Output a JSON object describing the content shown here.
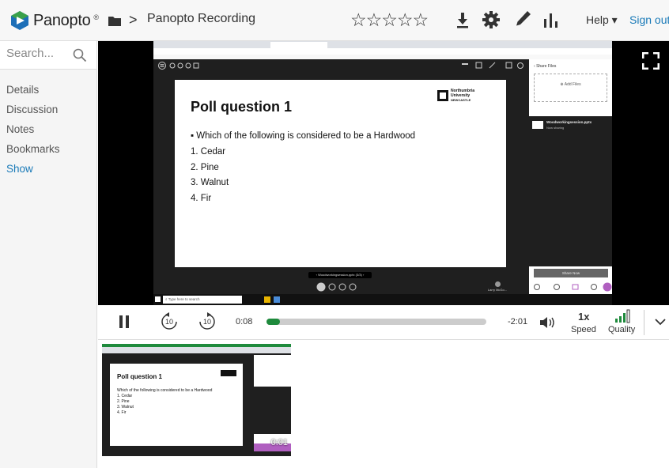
{
  "header": {
    "brand": "Panopto",
    "brand_mark": "®",
    "breadcrumb_separator": ">",
    "title": "Panopto Recording",
    "rating_stars": "☆☆☆☆☆",
    "help_label": "Help ▾",
    "signout_label": "Sign out"
  },
  "sidebar": {
    "search_placeholder": "Search...",
    "items": [
      {
        "label": "Details"
      },
      {
        "label": "Discussion"
      },
      {
        "label": "Notes"
      },
      {
        "label": "Bookmarks"
      },
      {
        "label": "Show"
      }
    ]
  },
  "slide": {
    "title": "Poll question 1",
    "question": "Which of the following is considered to be a Hardwood",
    "options": [
      "1.  Cedar",
      "2.  Pine",
      "3.  Walnut",
      "4.  Fir"
    ],
    "logo_lines": [
      "Northumbria",
      "University",
      "NEWCASTLE"
    ]
  },
  "teams": {
    "share_title": "Share Files",
    "add_files": "Add Files",
    "file_name": "Woodworkingsession.pptx",
    "now_sharing": "Now sharing",
    "share_now": "Share Now",
    "presentation_label": "Woodworkingsession.pptx (3/3)",
    "participant": "Larry McGo...",
    "taskbar_search": "Type here to search"
  },
  "player": {
    "elapsed": "0:08",
    "remaining": "-2:01",
    "progress": 0.06,
    "skip_back": "10",
    "skip_forward": "10",
    "speed_value": "1x",
    "speed_label": "Speed",
    "quality_label": "Quality"
  },
  "thumbnail": {
    "timestamp": "0:01",
    "title": "Poll question 1",
    "question": "Which of the following is considered to be a Hardwood",
    "options": [
      "1. Cedar",
      "2. Pine",
      "3. Walnut",
      "4. Fir"
    ]
  },
  "colors": {
    "accent_green": "#1e8a3c",
    "link_blue": "#1a7ab8",
    "logo_blue": "#1d6fb8",
    "logo_green": "#3aa14a"
  }
}
